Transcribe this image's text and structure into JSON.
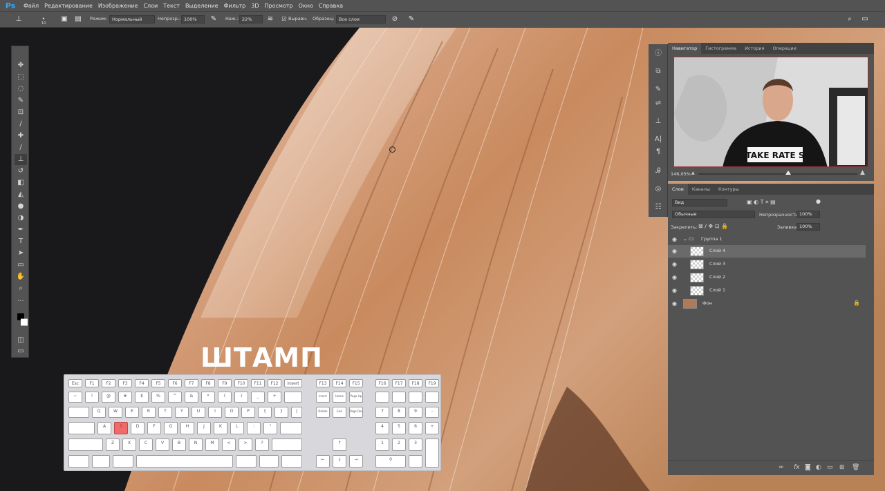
{
  "app": {
    "logo": "Ps"
  },
  "menu": [
    "Файл",
    "Редактирование",
    "Изображение",
    "Слои",
    "Текст",
    "Выделение",
    "Фильтр",
    "3D",
    "Просмотр",
    "Окно",
    "Справка"
  ],
  "options": {
    "mode_label": "Режим:",
    "mode_value": "Нормальный",
    "opacity_label": "Непрозр.:",
    "opacity_value": "100%",
    "pressure_label": "Наж.:",
    "pressure_value": "22%",
    "aligned_label": "Выравн.",
    "sample_label": "Образец:",
    "sample_value": "Все слои",
    "brush_size": "10"
  },
  "nav_panel": {
    "tabs": [
      "Навигатор",
      "Гистограмма",
      "История",
      "Операции"
    ],
    "zoom": "146,05%",
    "shirt_text": "TAKE RATE S"
  },
  "layers_panel": {
    "tabs": [
      "Слои",
      "Каналы",
      "Контуры"
    ],
    "kind_label": "Вид",
    "blend_mode": "Обычные",
    "opacity_label": "Непрозрачность:",
    "opacity_value": "100%",
    "lock_label": "Закрепить:",
    "fill_label": "Заливка:",
    "fill_value": "100%",
    "group_name": "Группа 1",
    "layers": [
      "Слой 4",
      "Слой 3",
      "Слой 2",
      "Слой 1"
    ],
    "background_name": "Фон"
  },
  "overlay": {
    "title": "ШТАМП"
  },
  "keyboard": {
    "row_fn": [
      "Esc",
      "F1",
      "F2",
      "F3",
      "F4",
      "F5",
      "F6",
      "F7",
      "F8",
      "F9",
      "F10",
      "F11",
      "F12",
      "Insert"
    ],
    "row_fn2": [
      "F13",
      "F14",
      "F15",
      "F16",
      "F17",
      "F18",
      "F19"
    ],
    "row_num": [
      "~",
      "!",
      "@",
      "#",
      "$",
      "%",
      "^",
      "&",
      "*",
      "(",
      ")",
      "_",
      "+"
    ],
    "row_q": [
      "Q",
      "W",
      "E",
      "R",
      "T",
      "Y",
      "U",
      "I",
      "O",
      "P",
      "{",
      "}",
      "|"
    ],
    "row_a": [
      "A",
      "S",
      "D",
      "F",
      "G",
      "H",
      "J",
      "K",
      "L",
      ":",
      "\""
    ],
    "row_z": [
      "Z",
      "X",
      "C",
      "V",
      "B",
      "N",
      "M",
      "<",
      ">",
      "?"
    ],
    "highlighted": "S",
    "nav_keys": [
      "Insert",
      "Home",
      "Page Up",
      "Delete",
      "End",
      "Page Down"
    ],
    "numpad": [
      "7",
      "8",
      "9",
      "-",
      "4",
      "5",
      "6",
      "+",
      "1",
      "2",
      "3",
      "0"
    ]
  },
  "colors": {
    "accent": "#31a8ff",
    "panel": "#535353",
    "highlight_key": "#f06a6a"
  }
}
